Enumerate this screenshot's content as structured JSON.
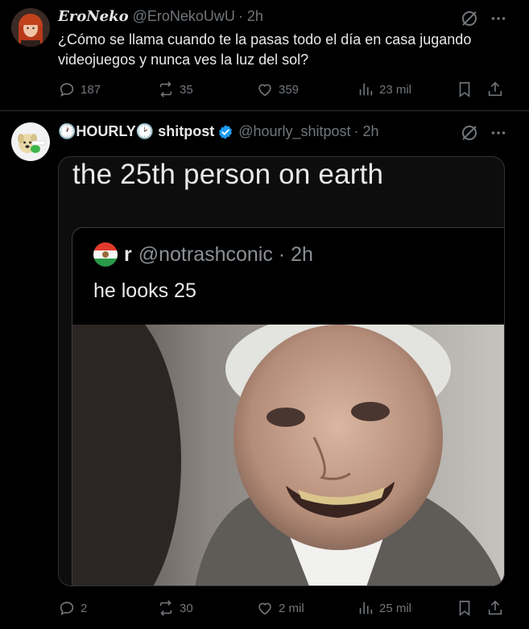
{
  "post1": {
    "display_name": "𝑬𝒓𝒐𝑵𝒆𝒌𝒐",
    "handle": "@EroNekoUwU",
    "time": "· 2h",
    "text": "¿Cómo se llama cuando te la pasas todo el día en casa jugando videojuegos y nunca ves la luz del sol?",
    "stats": {
      "replies": "187",
      "reposts": "35",
      "likes": "359",
      "views": "23 mil"
    }
  },
  "post2": {
    "display_name_prefix": "🕐",
    "display_name_main": "HOURLY",
    "display_name_mid": "🕑",
    "display_name_suffix": " shitpost",
    "handle": "@hourly_shitpost",
    "time": "· 2h",
    "media": {
      "title": "the 25th person on earth",
      "quoted_name": "r",
      "quoted_handle": "@notrashconic · 2h",
      "quoted_text": "he looks 25"
    },
    "stats": {
      "replies": "2",
      "reposts": "30",
      "likes": "2 mil",
      "views": "25 mil"
    }
  },
  "colors": {
    "background": "#000000",
    "text": "#e7e9ea",
    "muted": "#71767b",
    "verified": "#1d9bf0",
    "divider": "#2f3336"
  }
}
